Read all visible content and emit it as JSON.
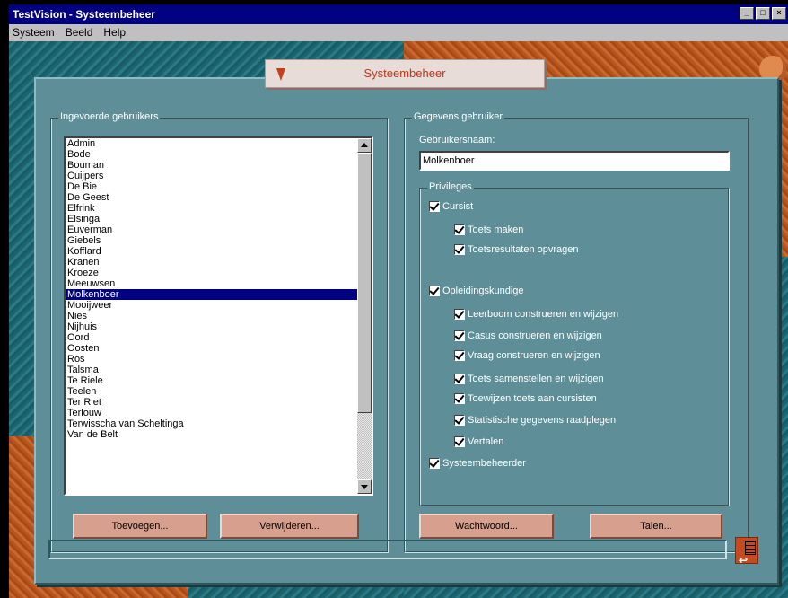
{
  "window": {
    "title": "TestVision - Systeembeheer",
    "buttons": [
      "_",
      "□",
      "×"
    ]
  },
  "menu": {
    "items": [
      {
        "label": "Systeem"
      },
      {
        "label": "Beeld"
      },
      {
        "label": "Help"
      }
    ]
  },
  "header": {
    "title": "Systeembeheer"
  },
  "users_group": {
    "legend": "Ingevoerde gebruikers",
    "users": [
      "Admin",
      "Bode",
      "Bouman",
      "Cuijpers",
      "De Bie",
      "De Geest",
      "Elfrink",
      "Elsinga",
      "Euverman",
      "Giebels",
      "Kofflard",
      "Kranen",
      "Kroeze",
      "Meeuwsen",
      "Molkenboer",
      "Mooijweer",
      "Nies",
      "Nijhuis",
      "Oord",
      "Oosten",
      "Ros",
      "Talsma",
      "Te Riele",
      "Teelen",
      "Ter Riet",
      "Terlouw",
      "Terwisscha van Scheltinga",
      "Van de Belt"
    ],
    "selected": "Molkenboer",
    "add_button": "Toevoegen...",
    "remove_button": "Verwijderen..."
  },
  "details_group": {
    "legend": "Gegevens gebruiker",
    "username_label": "Gebruikersnaam:",
    "username_value": "Molkenboer",
    "privileges_legend": "Privileges",
    "privileges": [
      {
        "label": "Cursist",
        "checked": true,
        "level": 0
      },
      {
        "label": "Toets maken",
        "checked": true,
        "level": 1
      },
      {
        "label": "Toetsresultaten opvragen",
        "checked": true,
        "level": 1
      },
      {
        "label": "Opleidingskundige",
        "checked": true,
        "level": 0
      },
      {
        "label": "Leerboom construeren en wijzigen",
        "checked": true,
        "level": 1
      },
      {
        "label": "Casus construeren en wijzigen",
        "checked": true,
        "level": 1
      },
      {
        "label": "Vraag construeren en wijzigen",
        "checked": true,
        "level": 1
      },
      {
        "label": "Toets samenstellen en wijzigen",
        "checked": true,
        "level": 1
      },
      {
        "label": "Toewijzen toets aan cursisten",
        "checked": true,
        "level": 1
      },
      {
        "label": "Statistische gegevens raadplegen",
        "checked": true,
        "level": 1
      },
      {
        "label": "Vertalen",
        "checked": true,
        "level": 1
      },
      {
        "label": "Systeembeheerder",
        "checked": true,
        "level": 0
      }
    ],
    "password_button": "Wachtwoord...",
    "languages_button": "Talen..."
  },
  "colors": {
    "panel": "#5e8f98",
    "button": "#d7a08e",
    "selection": "#000080",
    "accent": "#c4401a"
  }
}
